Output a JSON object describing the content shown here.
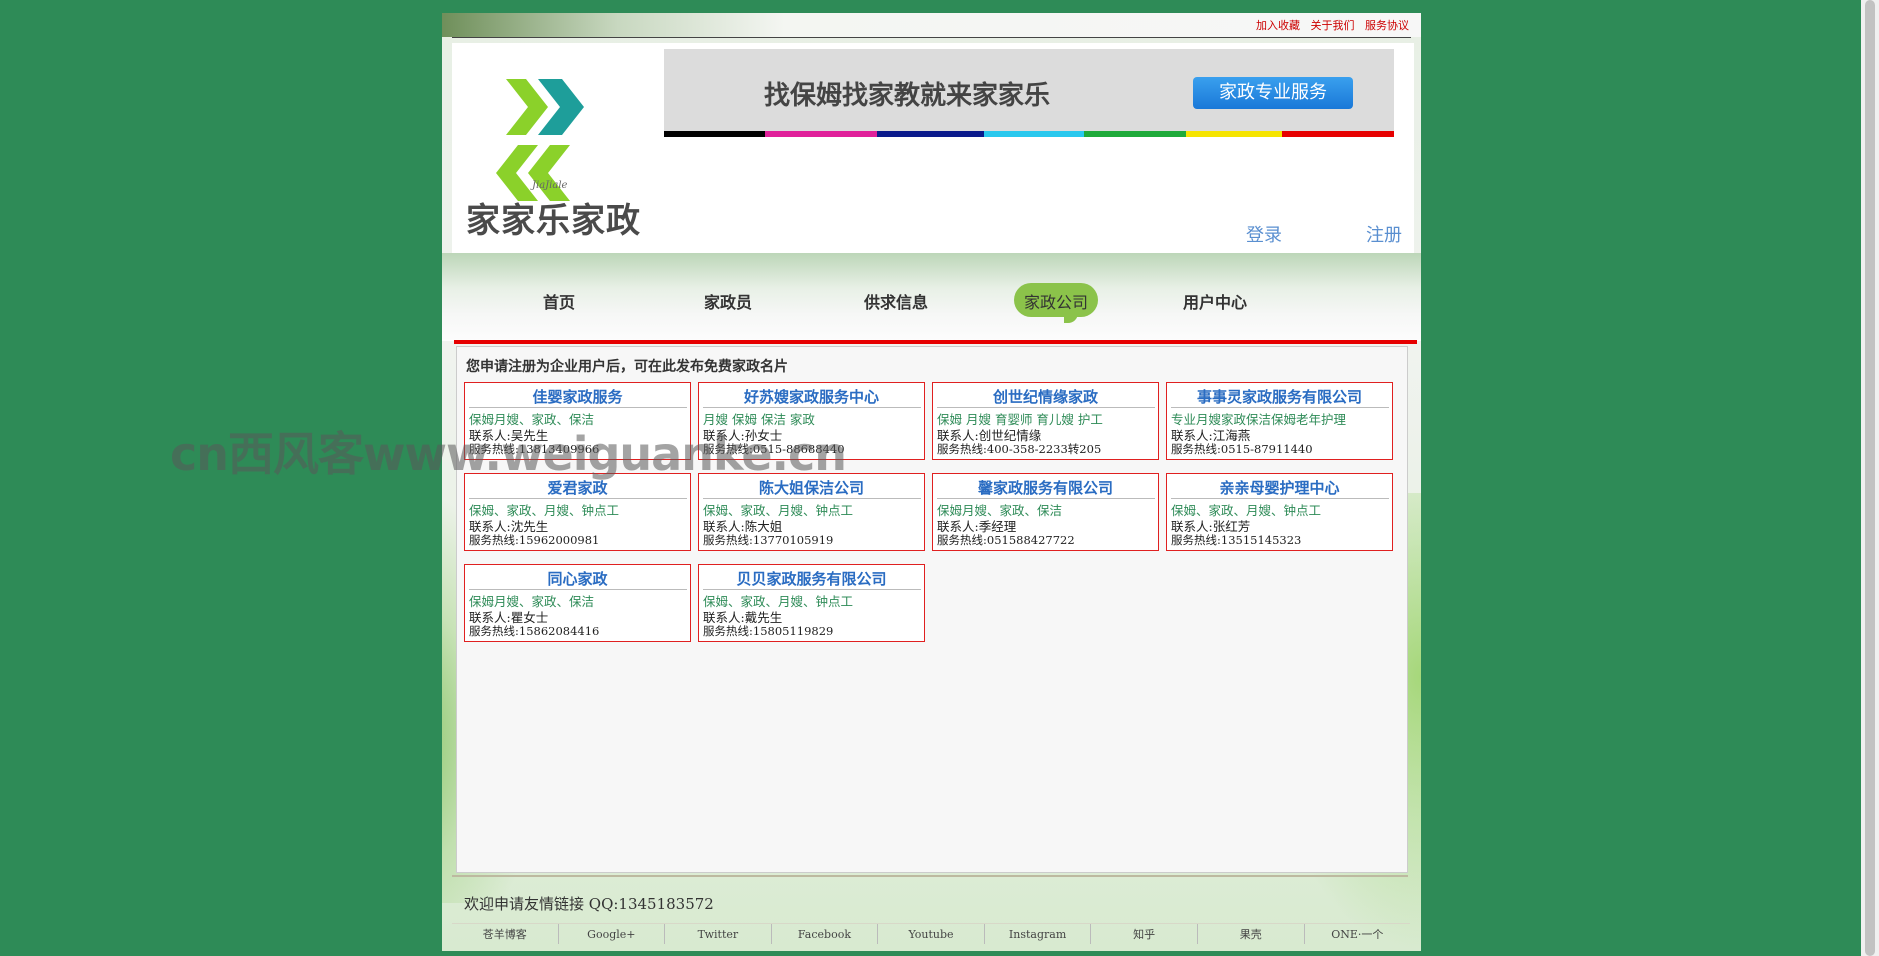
{
  "top_links": [
    "加入收藏",
    "关于我们",
    "服务协议"
  ],
  "header": {
    "logo_small": "JiaJiale",
    "logo_text": "家家乐家政",
    "banner_text": "找保姆找家教就来家家乐",
    "banner_button": "家政专业服务",
    "login": "登录",
    "register": "注册"
  },
  "nav": {
    "items": [
      "首页",
      "家政员",
      "供求信息",
      "家政公司",
      "用户中心"
    ],
    "active": "家政公司"
  },
  "main": {
    "notice": "您申请注册为企业用户后，可在此发布免费家政名片",
    "companies": [
      {
        "name": "佳婴家政服务",
        "services": "保姆月嫂、家政、保洁",
        "contact": "联系人:吴先生",
        "phone": "服务热线:13813409966"
      },
      {
        "name": "好苏嫂家政服务中心",
        "services": "月嫂 保姆 保洁 家政",
        "contact": "联系人:孙女士",
        "phone": "服务热线:0515-88688440"
      },
      {
        "name": "创世纪情缘家政",
        "services": "保姆 月嫂 育婴师 育儿嫂 护工",
        "contact": "联系人:创世纪情缘",
        "phone": "服务热线:400-358-2233转205"
      },
      {
        "name": "事事灵家政服务有限公司",
        "services": "专业月嫂家政保洁保姆老年护理",
        "contact": "联系人:江海燕",
        "phone": "服务热线:0515-87911440"
      },
      {
        "name": "爱君家政",
        "services": "保姆、家政、月嫂、钟点工",
        "contact": "联系人:沈先生",
        "phone": "服务热线:15962000981"
      },
      {
        "name": "陈大姐保洁公司",
        "services": "保姆、家政、月嫂、钟点工",
        "contact": "联系人:陈大姐",
        "phone": "服务热线:13770105919"
      },
      {
        "name": "馨家政服务有限公司",
        "services": "保姆月嫂、家政、保洁",
        "contact": "联系人:季经理",
        "phone": "服务热线:051588427722"
      },
      {
        "name": "亲亲母婴护理中心",
        "services": "保姆、家政、月嫂、钟点工",
        "contact": "联系人:张红芳",
        "phone": "服务热线:13515145323"
      },
      {
        "name": "同心家政",
        "services": "保姆月嫂、家政、保洁",
        "contact": "联系人:瞿女士",
        "phone": "服务热线:15862084416"
      },
      {
        "name": "贝贝家政服务有限公司",
        "services": "保姆、家政、月嫂、钟点工",
        "contact": "联系人:戴先生",
        "phone": "服务热线:15805119829"
      }
    ]
  },
  "watermark": "cn西风客www.weiguanke.cn",
  "footer": {
    "title": "欢迎申请友情链接 QQ:1345183572",
    "links": [
      "苍羊博客",
      "Google+",
      "Twitter",
      "Facebook",
      "Youtube",
      "Instagram",
      "知乎",
      "果壳",
      "ONE·一个"
    ]
  },
  "colors": {
    "background": "#2e8b57",
    "accent_red": "#e60000",
    "link_blue": "#2a6cc2",
    "service_green": "#2e8b57",
    "nav_active": "#8bc34a",
    "colorbar": [
      "#000000",
      "#e0219a",
      "#0a1a8c",
      "#29c8ee",
      "#1faa3a",
      "#f5e400",
      "#e60000"
    ]
  }
}
